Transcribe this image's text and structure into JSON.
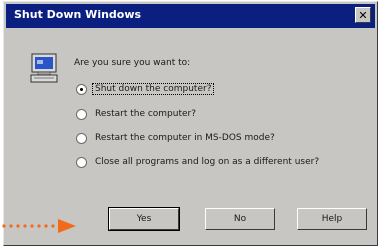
{
  "window": {
    "title": "Shut Down Windows",
    "close_glyph": "✕"
  },
  "dialog": {
    "icon": "computer-icon",
    "prompt": "Are you sure you want to:",
    "options": [
      {
        "label": "Shut down the computer?",
        "checked": true
      },
      {
        "label": "Restart the computer?",
        "checked": false
      },
      {
        "label": "Restart the computer in MS-DOS mode?",
        "checked": false
      },
      {
        "label": "Close all programs and log on as a different user?",
        "checked": false
      }
    ]
  },
  "buttons": {
    "yes": "Yes",
    "no": "No",
    "help": "Help"
  },
  "annotation": {
    "icon": "dotted-arrow-icon",
    "color": "#f26a1b"
  }
}
